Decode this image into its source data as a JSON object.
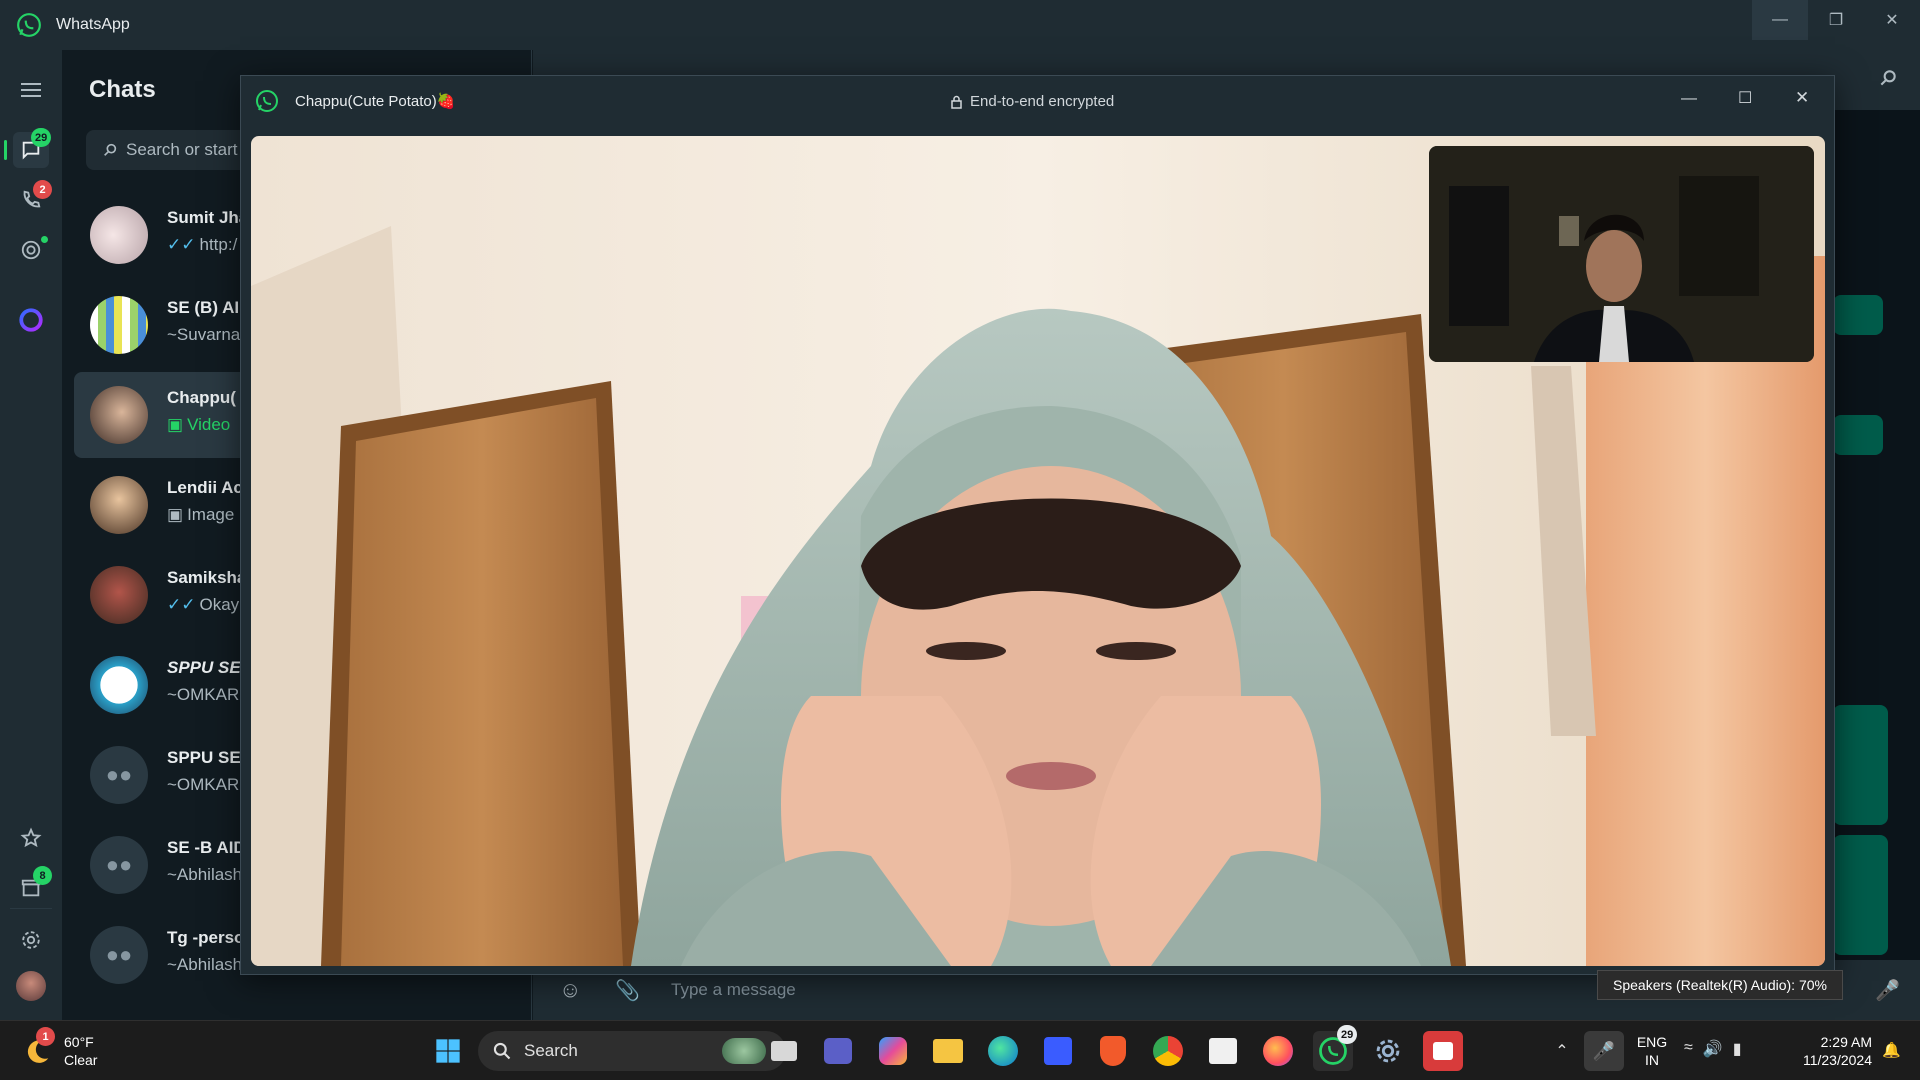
{
  "app": {
    "title": "WhatsApp"
  },
  "sidebar": {
    "chats_badge": "29",
    "calls_badge": "2",
    "archive_badge": "8"
  },
  "chatlist": {
    "title": "Chats",
    "search_placeholder": "Search or start",
    "items": [
      {
        "name": "Sumit Jha",
        "preview": "http:/",
        "ticks": true
      },
      {
        "name": "SE (B) AI",
        "preview": "~Suvarna"
      },
      {
        "name": "Chappu(",
        "preview": "Video",
        "video": true
      },
      {
        "name": "Lendii Ac",
        "preview": "Image",
        "image": true
      },
      {
        "name": "Samiksha",
        "preview": "Okay",
        "ticks": true
      },
      {
        "name": "SPPU SE",
        "preview": "~OMKAR"
      },
      {
        "name": "SPPU SE",
        "preview": "~OMKAR"
      },
      {
        "name": "SE -B AID",
        "preview": "~Abhilash"
      },
      {
        "name": "Tg -perso",
        "preview": "~Abhilash"
      }
    ]
  },
  "composer": {
    "placeholder": "Type a message"
  },
  "call": {
    "title": "Chappu(Cute Potato)🍓",
    "encryption": "End-to-end encrypted"
  },
  "tooltip": {
    "text": "Speakers (Realtek(R) Audio): 70%"
  },
  "taskbar": {
    "weather_temp": "60°F",
    "weather_desc": "Clear",
    "weather_badge": "1",
    "search_label": "Search",
    "whatsapp_badge": "29",
    "lang_top": "ENG",
    "lang_bottom": "IN",
    "time": "2:29 AM",
    "date": "11/23/2024"
  },
  "colors": {
    "accent": "#25d366",
    "panel": "#1f2c33",
    "bg": "#111b21"
  }
}
